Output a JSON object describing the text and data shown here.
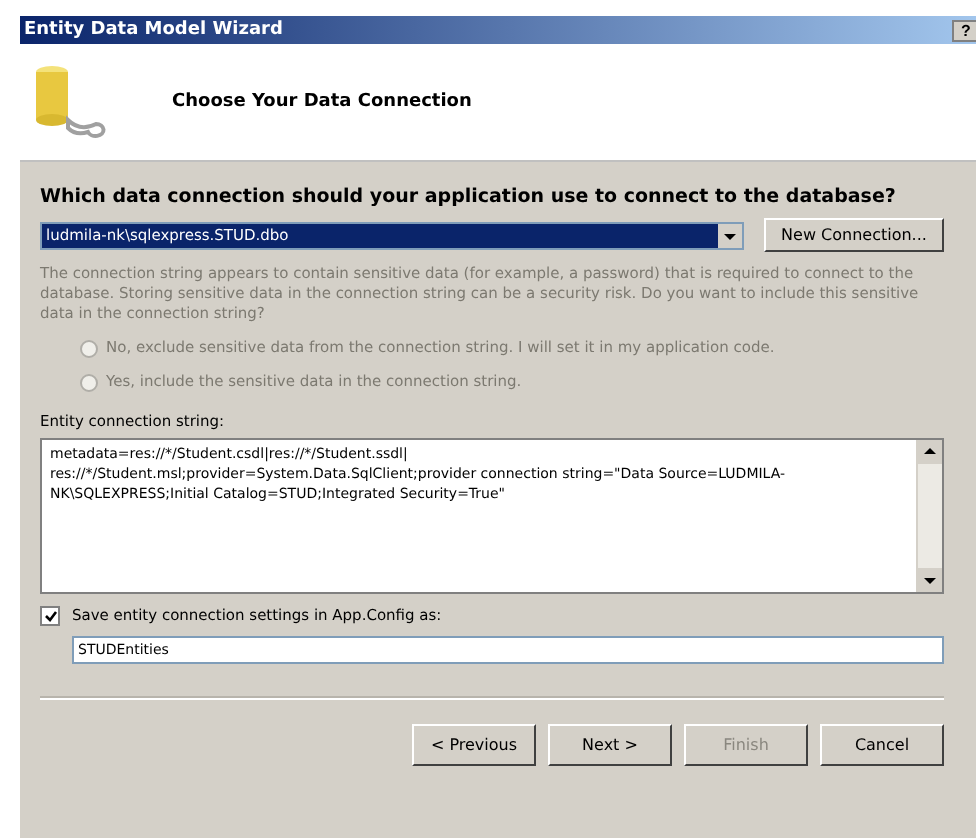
{
  "window": {
    "title": "Entity Data Model Wizard",
    "help_button": "?"
  },
  "header": {
    "title": "Choose Your Data Connection"
  },
  "question": "Which data connection should your application use to connect to the database?",
  "connection": {
    "value": "ludmila-nk\\sqlexpress.STUD.dbo",
    "new_button": "New Connection..."
  },
  "sensitive": {
    "text": "The connection string appears to contain sensitive data (for example, a password) that is required to connect to the database. Storing sensitive data in the connection string can be a security risk. Do you want to include this sensitive data in the connection string?",
    "disabled": true,
    "options": [
      {
        "label": "No, exclude sensitive data from the connection string. I will set it in my application code.",
        "selected": false,
        "disabled": true
      },
      {
        "label": "Yes, include the sensitive data in the connection string.",
        "selected": false,
        "disabled": true
      }
    ]
  },
  "entity_string": {
    "label": "Entity connection string:",
    "value": "metadata=res://*/Student.csdl|res://*/Student.ssdl|\nres://*/Student.msl;provider=System.Data.SqlClient;provider connection string=\"Data Source=LUDMILA-NK\\SQLEXPRESS;Initial Catalog=STUD;Integrated Security=True\""
  },
  "save": {
    "label": "Save entity connection settings in App.Config as:",
    "checked": true,
    "value": "STUDEntities"
  },
  "buttons": [
    {
      "label": "< Previous",
      "disabled": false
    },
    {
      "label": "Next >",
      "disabled": false
    },
    {
      "label": "Finish",
      "disabled": true
    },
    {
      "label": "Cancel",
      "disabled": false
    }
  ]
}
